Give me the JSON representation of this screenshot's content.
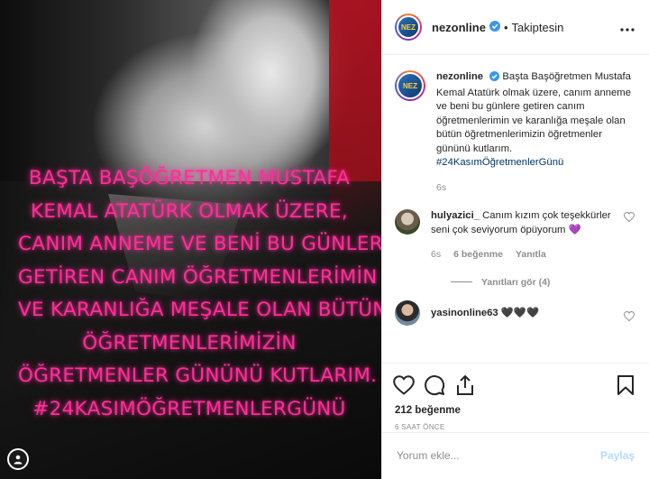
{
  "media": {
    "overlay_lines": [
      "BAŞTA BAŞÖĞRETMEN MUSTAFA",
      "KEMAL ATATÜRK OLMAK ÜZERE,",
      "CANIM ANNEME VE BENİ BU GÜNLERE",
      "GETİREN CANIM ÖĞRETMENLERİMİN",
      "VE KARANLIĞA MEŞALE OLAN BÜTÜN",
      "ÖĞRETMENLERİMİZİN",
      "ÖĞRETMENLER GÜNÜNÜ KUTLARIM.",
      "#24KASIMÖĞRETMENLERGÜNÜ"
    ],
    "overlay_color": "#ff2e9a"
  },
  "header": {
    "avatar_text": "NEZ",
    "username": "nezonline",
    "separator": "•",
    "follow_status": "Takiptesin"
  },
  "caption": {
    "username": "nezonline",
    "text": "Başta Başöğretmen Mustafa Kemal Atatürk olmak üzere, canım anneme ve beni bu günlere getiren canım öğretmenlerimin ve karanlığa meşale olan bütün öğretmenlerimizin öğretmenler gününü kutlarım.",
    "hashtag": "#24KasımÖğretmenlerGünü",
    "time": "6s"
  },
  "comments": [
    {
      "username": "hulyazici_",
      "text": "Canım kızım çok teşekkürler seni çok seviyorum öpüyorum 💜",
      "time": "6s",
      "likes": "6 beğenme",
      "reply": "Yanıtla",
      "view_replies": "Yanıtları gör (4)"
    },
    {
      "username": "yasinonline63",
      "text": "🖤🖤🖤"
    }
  ],
  "actions": {
    "likes": "212 beğenme",
    "time_ago": "6 SAAT ÖNCE"
  },
  "add_comment": {
    "placeholder": "Yorum ekle...",
    "post_label": "Paylaş"
  },
  "colors": {
    "verified": "#3897f0",
    "hashtag": "#003569",
    "muted": "#8e8e8e",
    "post_disabled": "#b3dbff"
  }
}
